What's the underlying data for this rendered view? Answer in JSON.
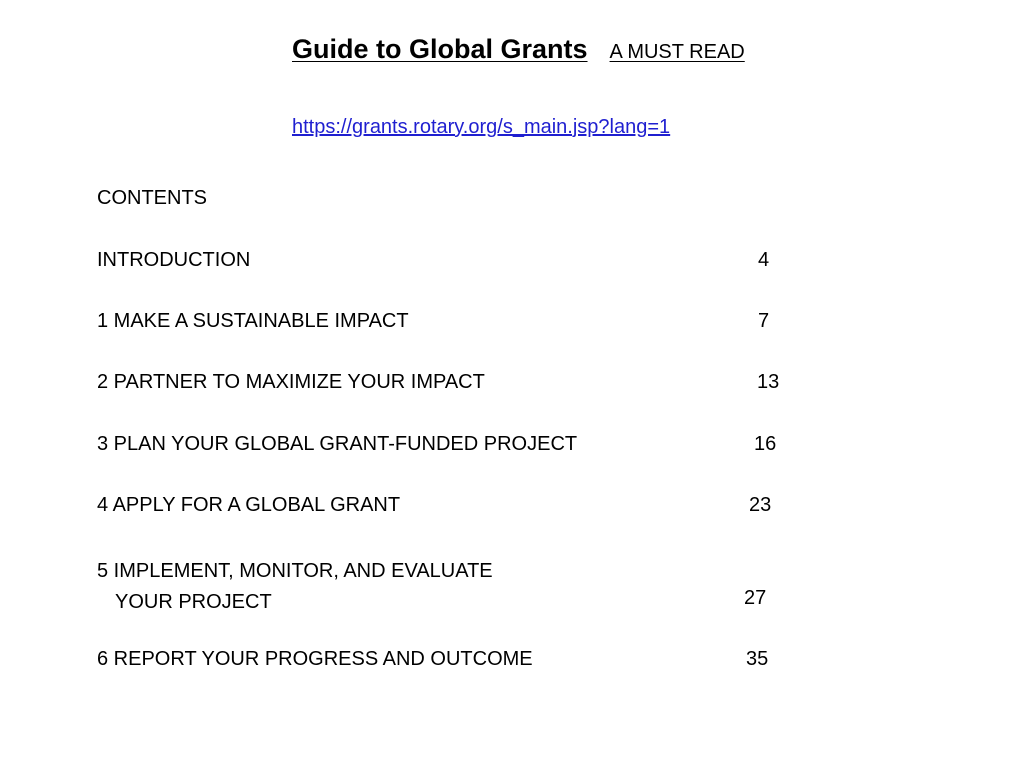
{
  "header": {
    "title": "Guide to Global Grants",
    "subtitle": "A MUST READ",
    "link": "https://grants.rotary.org/s_main.jsp?lang=1"
  },
  "contents": {
    "heading": "CONTENTS",
    "entries": [
      {
        "title": "INTRODUCTION",
        "page": "4"
      },
      {
        "title": "1 MAKE A SUSTAINABLE IMPACT",
        "page": "7"
      },
      {
        "title": "2 PARTNER TO MAXIMIZE YOUR IMPACT",
        "page": "13"
      },
      {
        "title": "3 PLAN YOUR GLOBAL GRANT-FUNDED PROJECT",
        "page": "16"
      },
      {
        "title": "4 APPLY FOR A GLOBAL GRANT",
        "page": "23"
      },
      {
        "title": "5 IMPLEMENT, MONITOR, AND EVALUATE",
        "title_cont": "YOUR PROJECT",
        "page": "27"
      },
      {
        "title": "6 REPORT YOUR PROGRESS AND OUTCOME",
        "page": "35"
      }
    ]
  }
}
